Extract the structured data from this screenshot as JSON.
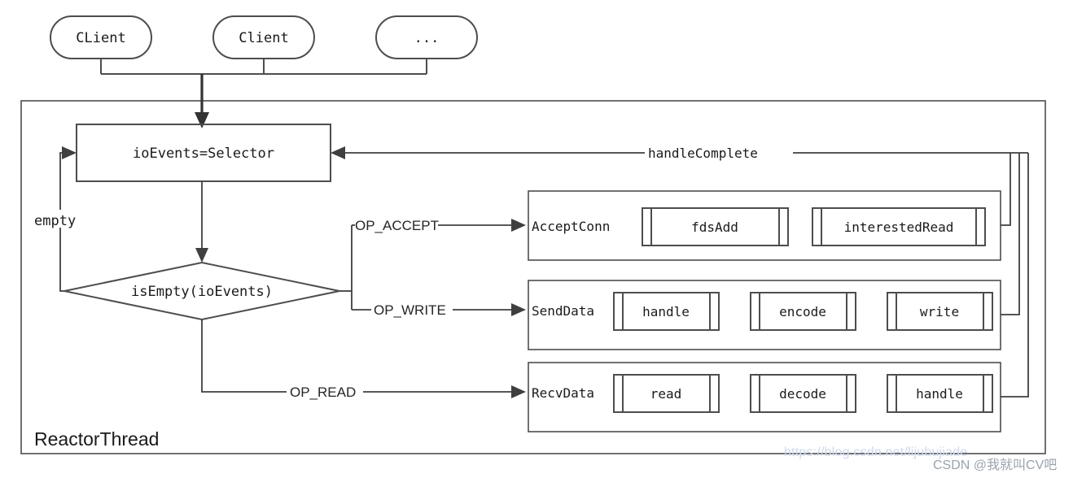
{
  "diagram": {
    "container_label": "ReactorThread",
    "clients": [
      {
        "id": "client-1",
        "label": "CLient"
      },
      {
        "id": "client-2",
        "label": "Client"
      },
      {
        "id": "client-3",
        "label": "..."
      }
    ],
    "selector_box": {
      "label": "ioEvents=Selector"
    },
    "decision": {
      "label": "isEmpty(ioEvents)"
    },
    "edge_labels": {
      "empty": "empty",
      "op_accept": "OP_ACCEPT",
      "op_write": "OP_WRITE",
      "op_read": "OP_READ",
      "handle_complete": "handleComplete"
    },
    "handlers": [
      {
        "id": "accept-conn",
        "name": "AcceptConn",
        "steps": [
          {
            "id": "fds-add",
            "label": "fdsAdd"
          },
          {
            "id": "interested-read",
            "label": "interestedRead"
          }
        ]
      },
      {
        "id": "send-data",
        "name": "SendData",
        "steps": [
          {
            "id": "send-handle",
            "label": "handle"
          },
          {
            "id": "encode",
            "label": "encode"
          },
          {
            "id": "write",
            "label": "write"
          }
        ]
      },
      {
        "id": "recv-data",
        "name": "RecvData",
        "steps": [
          {
            "id": "read",
            "label": "read"
          },
          {
            "id": "decode",
            "label": "decode"
          },
          {
            "id": "recv-handle",
            "label": "handle"
          }
        ]
      }
    ]
  },
  "watermark": {
    "url": "https://blog.csdn.net/lijubujiade",
    "author": "CSDN @我就叫CV吧"
  },
  "colors": {
    "background": "#ffffff",
    "stroke": "#4d4d4d",
    "line": "#3f3f3f",
    "text": "#1a1a1a",
    "watermark_url": "#cdd9ee",
    "watermark_author": "#9aa3ad"
  }
}
